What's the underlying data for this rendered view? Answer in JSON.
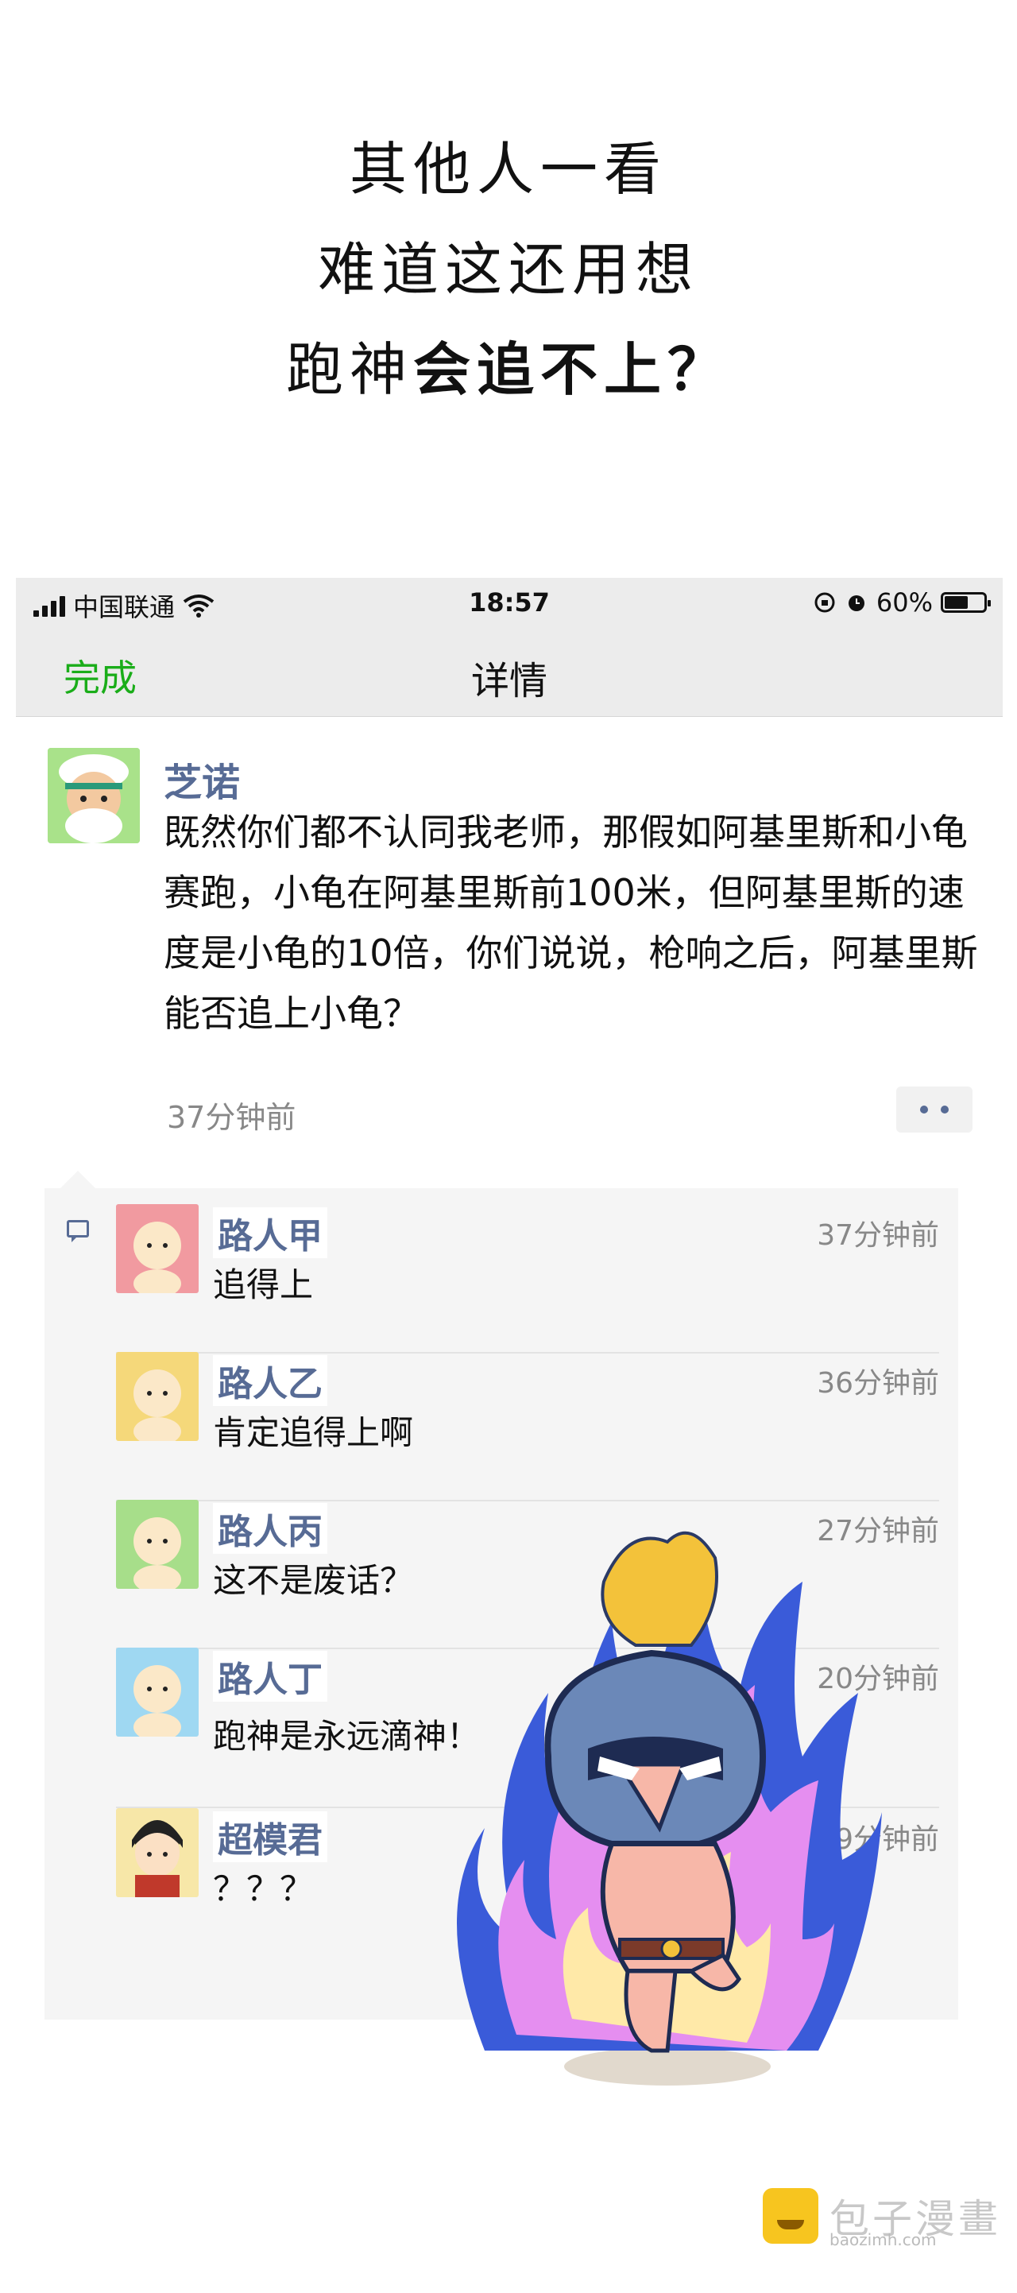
{
  "narration": {
    "line1": "其他人一看",
    "line2": "难道这还用想",
    "line3_part1": "跑神",
    "line3_part2": "会追不上？"
  },
  "status_bar": {
    "carrier": "中国联通",
    "time": "18:57",
    "battery": "60%",
    "battery_level": 0.6
  },
  "nav": {
    "done_label": "完成",
    "title": "详情"
  },
  "post": {
    "author": "芝诺",
    "text": "既然你们都不认同我老师，那假如阿基里斯和小龟赛跑，小龟在阿基里斯前100米，但阿基里斯的速度是小龟的10倍，你们说说，枪响之后，阿基里斯能否追上小龟？",
    "time": "37分钟前"
  },
  "comments": [
    {
      "name": "路人甲",
      "text": "追得上",
      "time": "37分钟前",
      "avatar_color": "#f19aa0"
    },
    {
      "name": "路人乙",
      "text": "肯定追得上啊",
      "time": "36分钟前",
      "avatar_color": "#f5d87a"
    },
    {
      "name": "路人丙",
      "text": "这不是废话？",
      "time": "27分钟前",
      "avatar_color": "#a7de8a"
    },
    {
      "name": "路人丁",
      "text": "跑神是永远滴神！",
      "time": "20分钟前",
      "avatar_color": "#9fd8f2"
    },
    {
      "name": "超模君",
      "text": "？？？",
      "time": "19分钟前",
      "avatar_color": "#f7e7a8"
    }
  ],
  "watermark": {
    "text": "包子漫畫",
    "url": "baozimh.com"
  }
}
